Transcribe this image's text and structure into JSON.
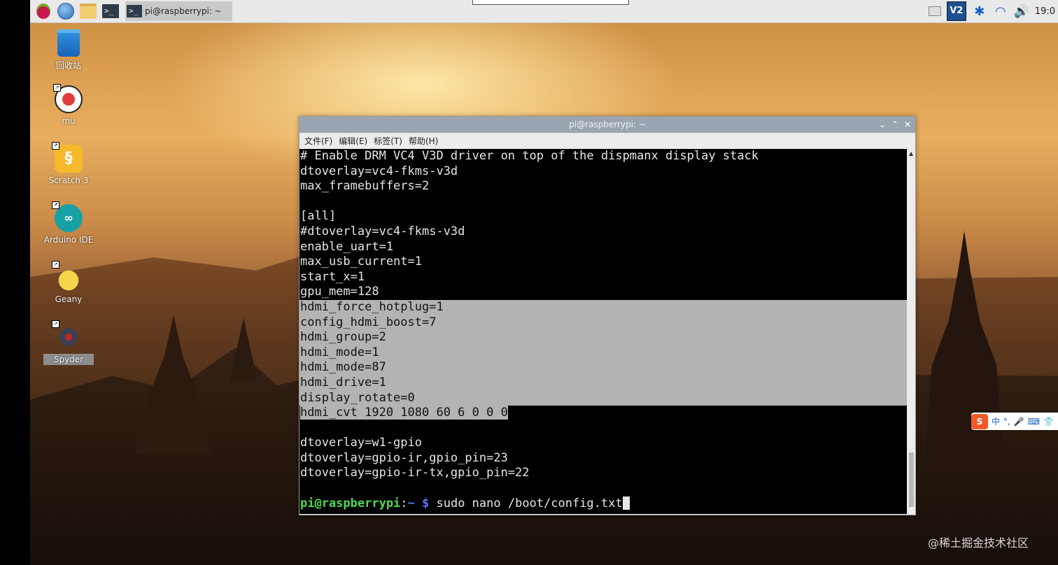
{
  "taskbar": {
    "task_title": "pi@raspberrypi: ~",
    "terminal_glyph": ">_",
    "vnc_label": "V2",
    "clock": "19:0"
  },
  "desktop_icons": [
    {
      "label": "回收站",
      "icon": "trash-icon"
    },
    {
      "label": "mu",
      "icon": "mu-icon"
    },
    {
      "label": "Scratch 3",
      "icon": "scratch-icon"
    },
    {
      "label": "Arduino IDE",
      "icon": "arduino-icon"
    },
    {
      "label": "Geany",
      "icon": "geany-icon"
    },
    {
      "label": "Spyder",
      "icon": "spyder-icon",
      "selected": true
    }
  ],
  "window": {
    "title": "pi@raspberrypi: ~",
    "menu": [
      "文件(F)",
      "编辑(E)",
      "标签(T)",
      "帮助(H)"
    ]
  },
  "terminal": {
    "lines": [
      "# Enable DRM VC4 V3D driver on top of the dispmanx display stack",
      "dtoverlay=vc4-fkms-v3d",
      "max_framebuffers=2",
      "",
      "[all]",
      "#dtoverlay=vc4-fkms-v3d",
      "enable_uart=1",
      "max_usb_current=1",
      "start_x=1",
      "gpu_mem=128",
      "hdmi_force_hotplug=1",
      "config_hdmi_boost=7",
      "hdmi_group=2",
      "hdmi_mode=1",
      "hdmi_mode=87",
      "hdmi_drive=1",
      "display_rotate=0",
      "hdmi_cvt 1920 1080 60 6 0 0 0",
      "",
      "dtoverlay=w1-gpio",
      "dtoverlay=gpio-ir,gpio_pin=23",
      "dtoverlay=gpio-ir-tx,gpio_pin=22",
      ""
    ],
    "prompt_user": "pi@raspberrypi",
    "prompt_sep": ":",
    "prompt_path": "~ $",
    "command": " sudo nano /boot/config.txt"
  },
  "ime": {
    "logo": "S",
    "mode": "中",
    "punct": "°,"
  },
  "watermark": "@稀土掘金技术社区",
  "colors": {
    "prompt_user": "#4fd94f",
    "prompt_path": "#5a78ff",
    "selection": "#b3b3b3"
  }
}
